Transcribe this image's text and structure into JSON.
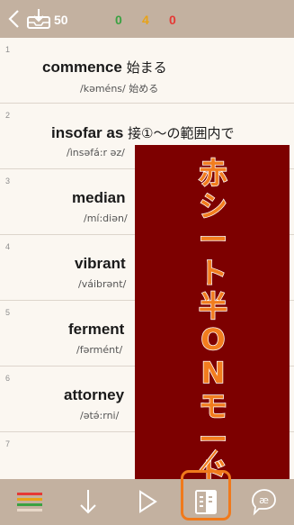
{
  "header": {
    "count": "50",
    "stats": [
      {
        "value": "0",
        "color": "#3aa142"
      },
      {
        "value": "4",
        "color": "#e8a317"
      },
      {
        "value": "0",
        "color": "#e53935"
      }
    ]
  },
  "words": [
    {
      "num": "1",
      "word": "commence",
      "meaning": "始まる",
      "pron": "/kəméns/ 始める"
    },
    {
      "num": "2",
      "word": "insofar as",
      "meaning": "接①〜の範囲内で",
      "pron": "/ìnsəfá:r əz/"
    },
    {
      "num": "3",
      "word": "median",
      "meaning": "",
      "pron": "/mí:diən/"
    },
    {
      "num": "4",
      "word": "vibrant",
      "meaning": "",
      "pron": "/váibrənt/"
    },
    {
      "num": "5",
      "word": "ferment",
      "meaning": "",
      "pron": "/fərmént/"
    },
    {
      "num": "6",
      "word": "attorney",
      "meaning": "",
      "pron": "/ətə́:rni/"
    },
    {
      "num": "7",
      "word": "",
      "meaning": "",
      "pron": ""
    }
  ],
  "overlay": {
    "label": "赤シート半ONモード",
    "sheet_color": "#7d0000",
    "label_color": "#f27d1e"
  },
  "toolbar": {
    "icons": [
      "list-icon",
      "down-arrow-icon",
      "play-icon",
      "red-sheet-toggle-icon",
      "pronunciation-icon"
    ],
    "highlight_color": "#f07a1c"
  }
}
